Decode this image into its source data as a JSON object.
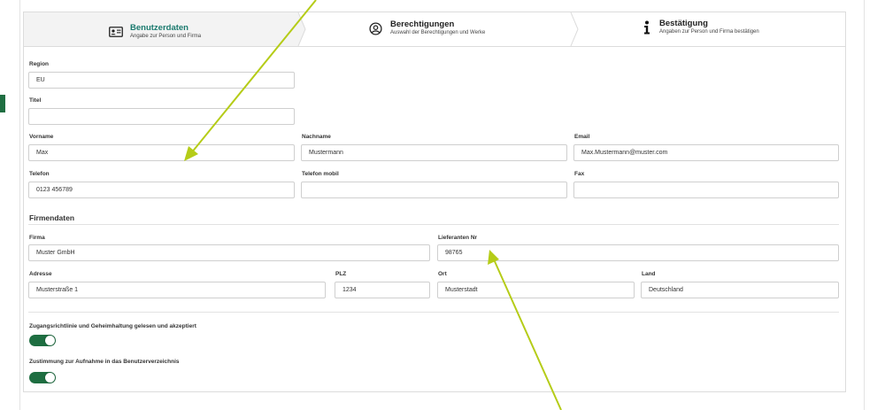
{
  "colors": {
    "accent_green": "#1e6e41",
    "active_step_title": "#1a7a6e",
    "annotation_arrow": "#b5cc18"
  },
  "stepper": {
    "steps": [
      {
        "title": "Benutzerdaten",
        "subtitle": "Angabe zur Person und Firma",
        "icon": "id-card-icon",
        "active": true
      },
      {
        "title": "Berechtigungen",
        "subtitle": "Auswahl der Berechtigungen und Werke",
        "icon": "at-sign-icon",
        "active": false
      },
      {
        "title": "Bestätigung",
        "subtitle": "Angaben zur Person und Firma bestätigen",
        "icon": "info-icon",
        "active": false
      }
    ]
  },
  "form": {
    "region": {
      "label": "Region",
      "value": "EU"
    },
    "titel": {
      "label": "Titel",
      "value": ""
    },
    "vorname": {
      "label": "Vorname",
      "value": "Max"
    },
    "nachname": {
      "label": "Nachname",
      "value": "Mustermann"
    },
    "email": {
      "label": "Email",
      "value": "Max.Mustermann@muster.com"
    },
    "telefon": {
      "label": "Telefon",
      "value": "0123 456789"
    },
    "telefon_mobil": {
      "label": "Telefon mobil",
      "value": ""
    },
    "fax": {
      "label": "Fax",
      "value": ""
    }
  },
  "firma_section": {
    "title": "Firmendaten",
    "firma": {
      "label": "Firma",
      "value": "Muster GmbH"
    },
    "lieferanten_nr": {
      "label": "Lieferanten Nr",
      "value": "98765"
    },
    "adresse": {
      "label": "Adresse",
      "value": "Musterstraße 1"
    },
    "plz": {
      "label": "PLZ",
      "value": "1234"
    },
    "ort": {
      "label": "Ort",
      "value": "Musterstadt"
    },
    "land": {
      "label": "Land",
      "value": "Deutschland"
    }
  },
  "consents": {
    "zugang": {
      "label": "Zugangsrichtlinie und Geheimhaltung gelesen und akzeptiert",
      "on": true
    },
    "verzeichnis": {
      "label": "Zustimmung zur Aufnahme in das Benutzerverzeichnis",
      "on": true
    }
  }
}
